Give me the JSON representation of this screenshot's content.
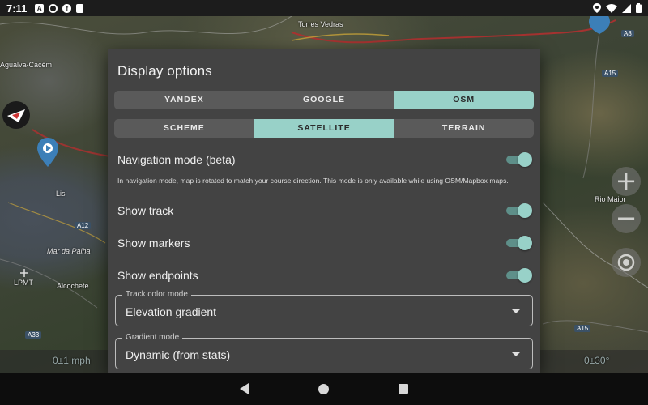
{
  "status_bar": {
    "time": "7:11",
    "left_icons": [
      "a-notification-icon",
      "record-icon",
      "f-notification-icon",
      "sd-card-icon"
    ],
    "right_icons": [
      "location-icon",
      "wifi-icon",
      "signal-icon",
      "battery-icon"
    ]
  },
  "map": {
    "labels": {
      "torres_vedras": "Torres Vedras",
      "agualva_cacem": "Agualva-Cacém",
      "lis": "Lis",
      "mar_da_palha": "Mar da Palha",
      "lpmt": "LPMT",
      "alcochete": "Alcochete",
      "rio_maior": "Rio Maior"
    },
    "road_tags": {
      "a12": "A12",
      "a33": "A33",
      "a15_top": "A15",
      "a15_bottom": "A15",
      "a8": "A8"
    },
    "speed": "0±1 mph",
    "heading": "0±30°",
    "zoom_in": "+",
    "zoom_out": "−"
  },
  "dialog": {
    "title": "Display options",
    "providers": [
      {
        "label": "YANDEX",
        "active": false
      },
      {
        "label": "GOOGLE",
        "active": false
      },
      {
        "label": "OSM",
        "active": true
      }
    ],
    "map_types": [
      {
        "label": "SCHEME",
        "active": false
      },
      {
        "label": "SATELLITE",
        "active": true
      },
      {
        "label": "TERRAIN",
        "active": false
      }
    ],
    "navigation_mode": {
      "label": "Navigation mode (beta)",
      "on": true,
      "note": "In navigation mode, map is rotated to match your course direction. This mode is only available while using OSM/Mapbox maps."
    },
    "show_track": {
      "label": "Show track",
      "on": true
    },
    "show_markers": {
      "label": "Show markers",
      "on": true
    },
    "show_endpoints": {
      "label": "Show endpoints",
      "on": true
    },
    "track_color_mode": {
      "legend": "Track color mode",
      "value": "Elevation gradient"
    },
    "gradient_mode": {
      "legend": "Gradient mode",
      "value": "Dynamic (from stats)"
    }
  },
  "colors": {
    "accent": "#98d1c8",
    "dialog_bg": "#434343",
    "segment_bg": "#5a5a5a"
  }
}
